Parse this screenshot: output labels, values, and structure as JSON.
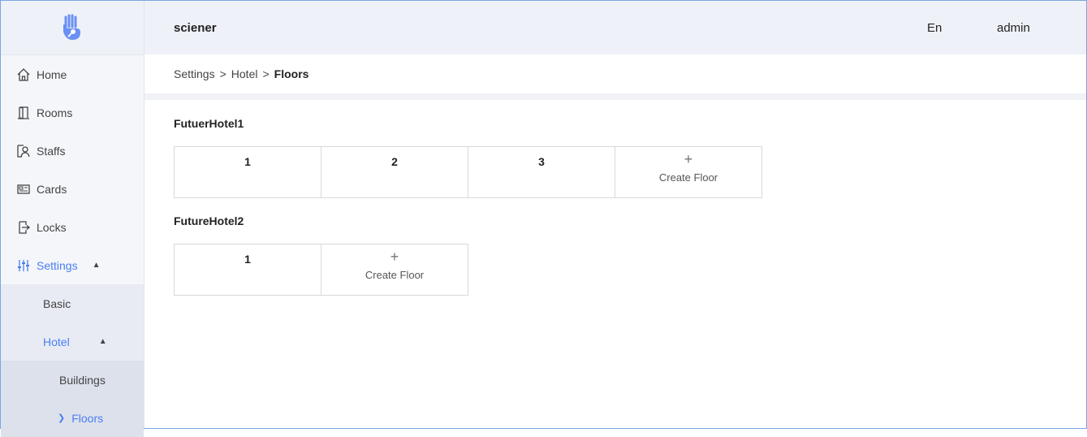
{
  "header": {
    "app_name": "sciener",
    "language": "En",
    "user": "admin"
  },
  "sidebar": {
    "items": [
      {
        "label": "Home",
        "icon": "home-icon"
      },
      {
        "label": "Rooms",
        "icon": "door-icon"
      },
      {
        "label": "Staffs",
        "icon": "staff-icon"
      },
      {
        "label": "Cards",
        "icon": "card-icon"
      },
      {
        "label": "Locks",
        "icon": "lock-icon"
      },
      {
        "label": "Settings",
        "icon": "sliders-icon"
      }
    ],
    "settings_sub": {
      "basic": "Basic",
      "hotel": "Hotel"
    },
    "hotel_sub": {
      "buildings": "Buildings",
      "floors": "Floors"
    }
  },
  "breadcrumb": {
    "level1": "Settings",
    "level2": "Hotel",
    "current": "Floors",
    "separator": ">"
  },
  "buildings": [
    {
      "name": "FutuerHotel1",
      "floors": [
        "1",
        "2",
        "3"
      ],
      "create_label": "Create Floor"
    },
    {
      "name": "FutureHotel2",
      "floors": [
        "1"
      ],
      "create_label": "Create Floor"
    }
  ],
  "colors": {
    "accent": "#4a7ef3",
    "sidebar_bg": "#f4f6fa",
    "header_bg": "#eef1f7"
  }
}
